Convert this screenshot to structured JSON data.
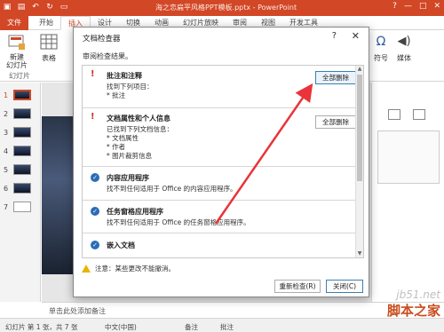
{
  "app": {
    "title": "海之恋扁平风格PPT模板.pptx - PowerPoint",
    "win_help": "?",
    "win_minimize": "—",
    "win_restore": "□",
    "win_close": "✕"
  },
  "ribbon": {
    "tabs": [
      "文件",
      "开始",
      "插入",
      "设计",
      "切换",
      "动画",
      "幻灯片放映",
      "审阅",
      "视图",
      "开发工具"
    ],
    "new_slide": "新建\n幻灯片",
    "slides_group": "幻灯片",
    "table": "表格",
    "symbol": "符号",
    "media": "媒体"
  },
  "slide_numbers": [
    "1",
    "2",
    "3",
    "4",
    "5",
    "6",
    "7"
  ],
  "notes_placeholder": "单击此处添加备注",
  "status": {
    "slide_info": "幻灯片 第 1 张，共 7 张",
    "language": "中文(中国)",
    "notes": "备注",
    "comments": "批注"
  },
  "dialog": {
    "title": "文档检查器",
    "help": "?",
    "close": "✕",
    "subtitle": "审阅检查结果。",
    "sections": [
      {
        "title": "批注和注释",
        "lines": [
          "找到下列项目：",
          "* 批注"
        ],
        "button": "全部删除"
      },
      {
        "title": "文档属性和个人信息",
        "lines": [
          "已找到下列文档信息：",
          "* 文档属性",
          "* 作者",
          "* 图片裁剪信息"
        ],
        "button": "全部删除"
      },
      {
        "title": "内容应用程序",
        "lines": [
          "找不到任何适用于 Office 的内容应用程序。"
        ]
      },
      {
        "title": "任务窗格应用程序",
        "lines": [
          "找不到任何适用于 Office 的任务窗格应用程序。"
        ]
      },
      {
        "title": "嵌入文档",
        "lines": []
      }
    ],
    "warning": "注意：某些更改不能撤消。",
    "reinspect": "重新检查(R)",
    "close_button": "关闭(C)"
  },
  "watermark": {
    "line1": "jb51.net",
    "line2": "脚本之家"
  },
  "colors": {
    "accent": "#d24726",
    "arrow": "#e8343a",
    "check": "#2b6cb8"
  }
}
